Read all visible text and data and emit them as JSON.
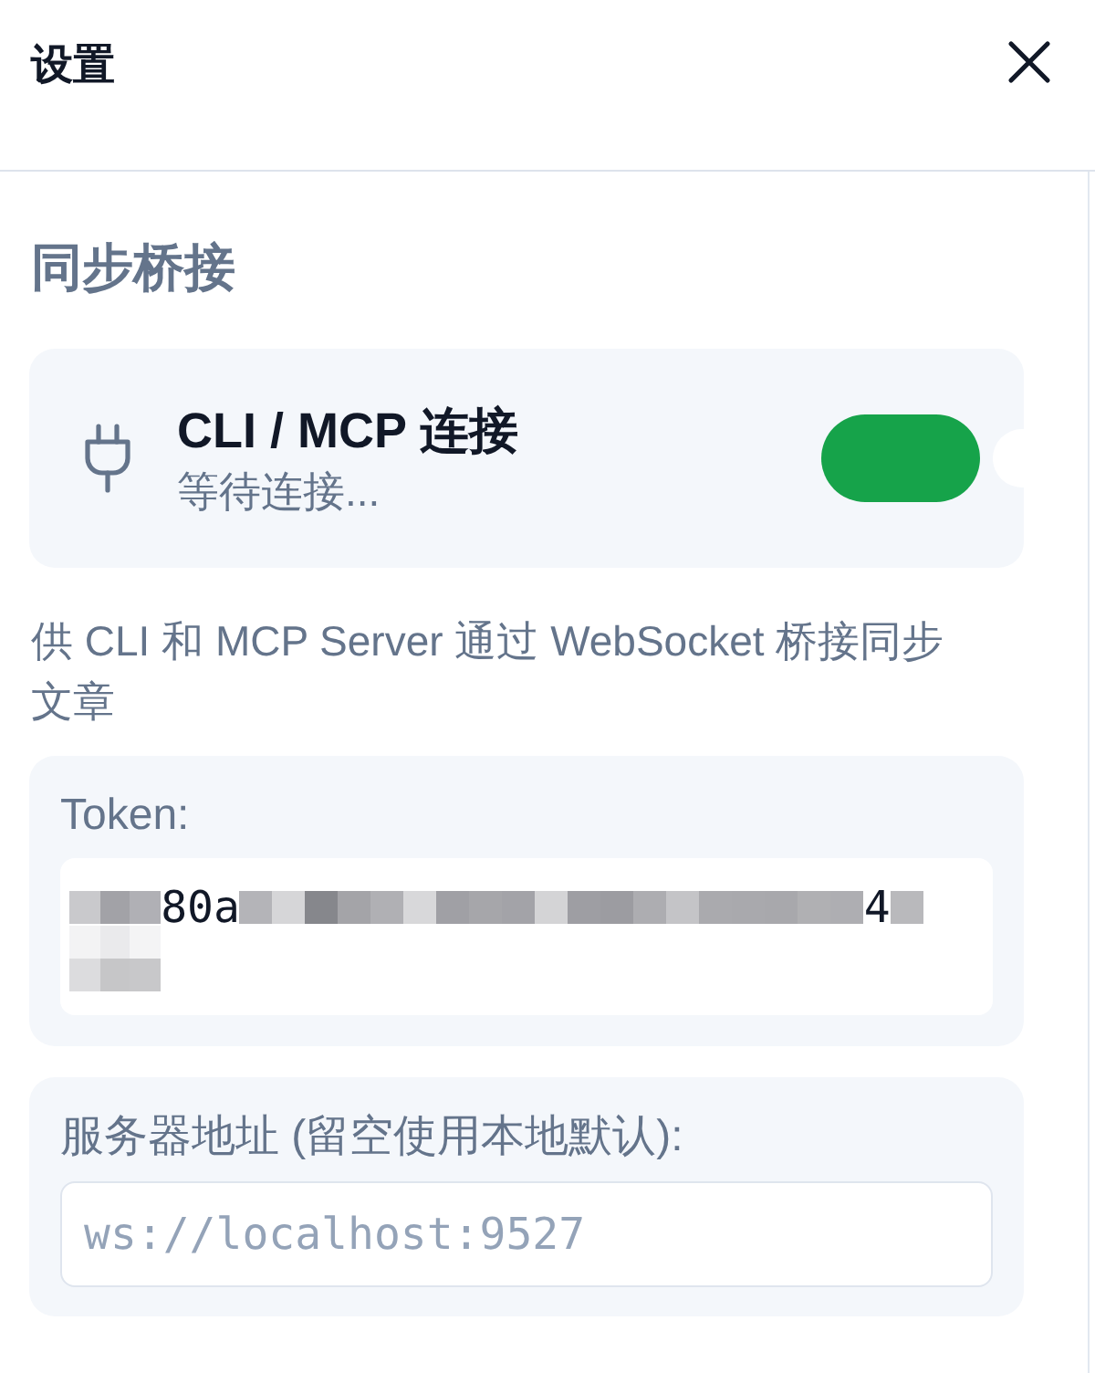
{
  "window": {
    "title": "设置"
  },
  "section": {
    "title": "同步桥接"
  },
  "connection": {
    "title": "CLI / MCP 连接",
    "status": "等待连接...",
    "on": true
  },
  "description": "供 CLI 和 MCP Server 通过 WebSocket 桥接同步文章",
  "token": {
    "label": "Token:",
    "visible_fragments": [
      "80a",
      "4"
    ]
  },
  "server": {
    "label": "服务器地址 (留空使用本地默认):",
    "placeholder": "ws://localhost:9527"
  }
}
